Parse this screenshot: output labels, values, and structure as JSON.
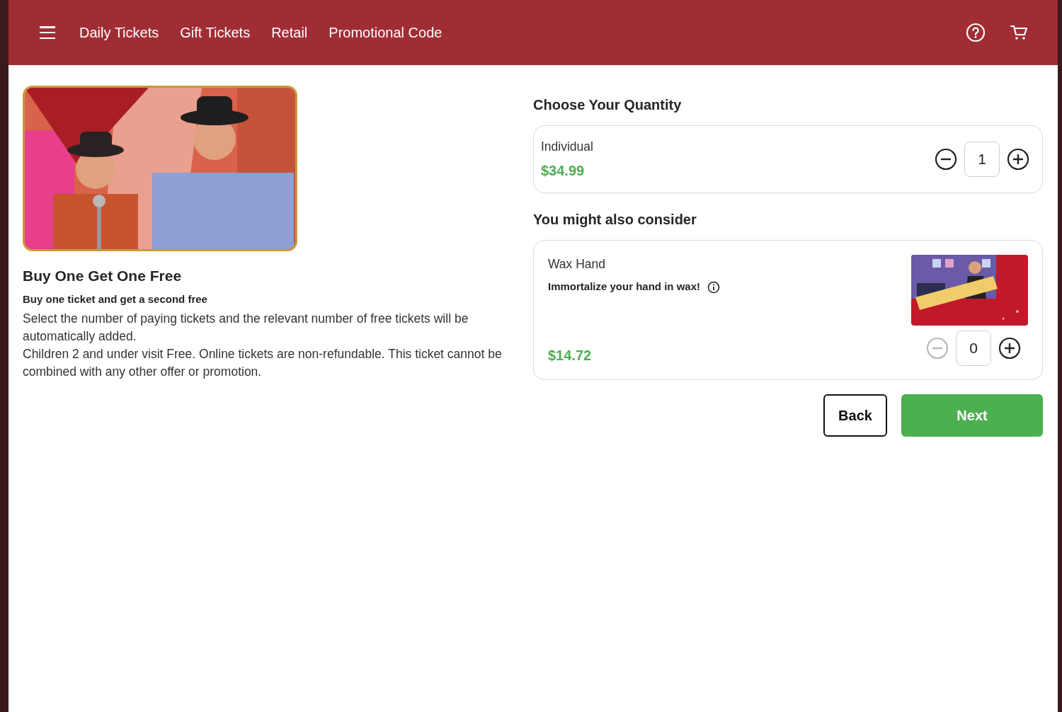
{
  "nav": {
    "links": [
      "Daily Tickets",
      "Gift Tickets",
      "Retail",
      "Promotional Code"
    ]
  },
  "offer": {
    "title": "Buy One Get One Free",
    "subtitle": "Buy one ticket and get a second free",
    "paragraphs": [
      "Select the number of paying tickets and the relevant number of free tickets will be automatically added.",
      "Children 2 and under visit Free. Online tickets are non-refundable. This ticket cannot be combined with any other offer or promotion."
    ]
  },
  "quantity": {
    "heading": "Choose Your Quantity",
    "items": [
      {
        "name": "Individual",
        "price": "$34.99",
        "quantity": "1",
        "minus_disabled": false
      }
    ]
  },
  "upsell": {
    "heading": "You might also consider",
    "items": [
      {
        "name": "Wax Hand",
        "description": "Immortalize your hand in wax!",
        "price": "$14.72",
        "quantity": "0",
        "minus_disabled": true
      }
    ]
  },
  "buttons": [
    {
      "label": "Back",
      "kind": "secondary"
    },
    {
      "label": "Next",
      "kind": "primary"
    }
  ]
}
